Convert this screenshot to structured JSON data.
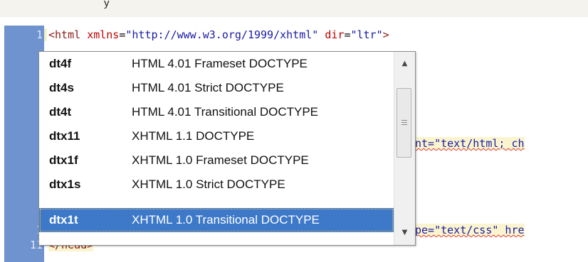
{
  "top_strip": {
    "text": "y"
  },
  "gutter": {
    "line_numbers": [
      "1",
      "1",
      "11"
    ]
  },
  "code": {
    "line1": {
      "open": "<html",
      "attr1": "xmlns",
      "eq1": "=",
      "val1": "\"http://www.w3.org/1999/xhtml\"",
      "attr2": "dir",
      "eq2": "=",
      "val2": "\"ltr\"",
      "close": ">"
    },
    "line5_fragment": "nt=\"text/html; ch",
    "line10_fragment": "pe=\"text/css\" hre",
    "line11": "</head>"
  },
  "autocomplete": {
    "items": [
      {
        "keyword": "dt4f",
        "description": "HTML 4.01 Frameset DOCTYPE"
      },
      {
        "keyword": "dt4s",
        "description": "HTML 4.01 Strict DOCTYPE"
      },
      {
        "keyword": "dt4t",
        "description": "HTML 4.01 Transitional DOCTYPE"
      },
      {
        "keyword": "dtx11",
        "description": "XHTML 1.1 DOCTYPE"
      },
      {
        "keyword": "dtx1f",
        "description": "XHTML 1.0 Frameset DOCTYPE"
      },
      {
        "keyword": "dtx1s",
        "description": "XHTML 1.0 Strict DOCTYPE"
      },
      {
        "keyword": "dtx1t",
        "description": "XHTML 1.0 Transitional DOCTYPE"
      }
    ],
    "selected_keyword": "dtx1t",
    "scroll_up_icon": "▲",
    "scroll_down_icon": "▼"
  },
  "colors": {
    "gutter": "#6f93cf",
    "selection": "#3d79c8",
    "tag": "#8b1a1a",
    "attribute": "#c00000",
    "value": "#1a1aa6"
  }
}
